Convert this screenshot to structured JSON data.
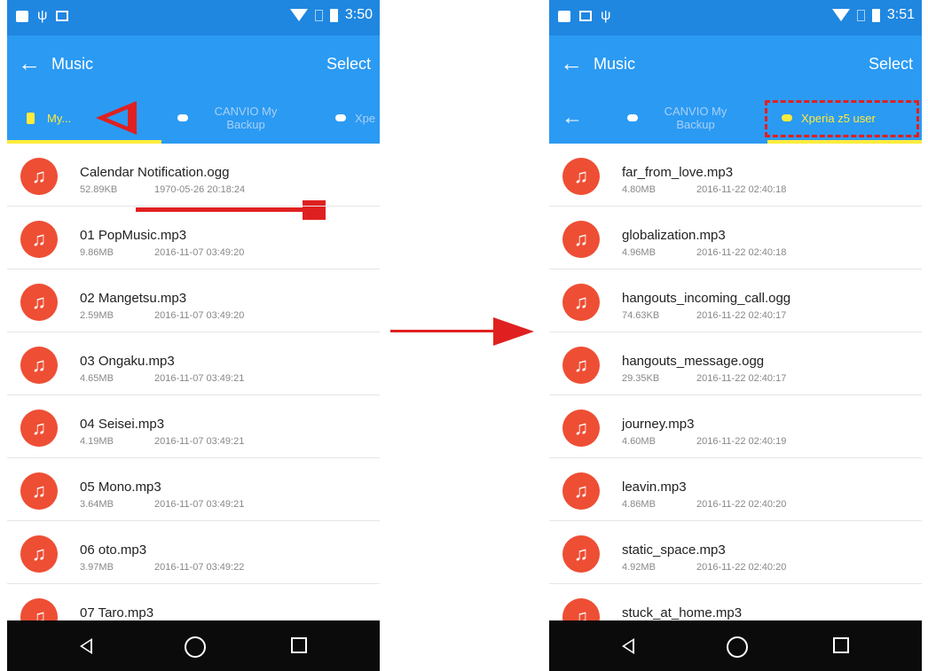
{
  "left_screen": {
    "status": {
      "time": "3:50"
    },
    "app_bar": {
      "title": "Music",
      "select_label": "Select"
    },
    "tabs": [
      {
        "label": "My..."
      },
      {
        "label": "CANVIO My Backup"
      },
      {
        "label": "Xpe"
      }
    ],
    "files": [
      {
        "name": "Calendar Notification.ogg",
        "size": "52.89KB",
        "date": "1970-05-26 20:18:24"
      },
      {
        "name": "01 PopMusic.mp3",
        "size": "9.86MB",
        "date": "2016-11-07 03:49:20"
      },
      {
        "name": "02 Mangetsu.mp3",
        "size": "2.59MB",
        "date": "2016-11-07 03:49:20"
      },
      {
        "name": "03 Ongaku.mp3",
        "size": "4.65MB",
        "date": "2016-11-07 03:49:21"
      },
      {
        "name": "04 Seisei.mp3",
        "size": "4.19MB",
        "date": "2016-11-07 03:49:21"
      },
      {
        "name": "05 Mono.mp3",
        "size": "3.64MB",
        "date": "2016-11-07 03:49:21"
      },
      {
        "name": "06 oto.mp3",
        "size": "3.97MB",
        "date": "2016-11-07 03:49:22"
      },
      {
        "name": "07 Taro.mp3"
      }
    ]
  },
  "right_screen": {
    "status": {
      "time": "3:51"
    },
    "app_bar": {
      "title": "Music",
      "select_label": "Select"
    },
    "tabs": [
      {
        "label": "CANVIO My Backup"
      },
      {
        "label": "Xperia z5 user"
      }
    ],
    "files": [
      {
        "name": "far_from_love.mp3",
        "size": "4.80MB",
        "date": "2016-11-22 02:40:18"
      },
      {
        "name": "globalization.mp3",
        "size": "4.96MB",
        "date": "2016-11-22 02:40:18"
      },
      {
        "name": "hangouts_incoming_call.ogg",
        "size": "74.63KB",
        "date": "2016-11-22 02:40:17"
      },
      {
        "name": "hangouts_message.ogg",
        "size": "29.35KB",
        "date": "2016-11-22 02:40:17"
      },
      {
        "name": "journey.mp3",
        "size": "4.60MB",
        "date": "2016-11-22 02:40:19"
      },
      {
        "name": "leavin.mp3",
        "size": "4.86MB",
        "date": "2016-11-22 02:40:20"
      },
      {
        "name": "static_space.mp3",
        "size": "4.92MB",
        "date": "2016-11-22 02:40:20"
      },
      {
        "name": "stuck_at_home.mp3"
      }
    ]
  },
  "colors": {
    "status_bar": "#1f87e0",
    "app_bar": "#2b9af3",
    "tab_indicator": "#ffeb3b",
    "music_icon": "#ee4e34",
    "annotation_red": "#e02020",
    "nav_bar": "#0b0b0b"
  },
  "icons": {
    "back": "arrow-left-icon",
    "music": "music-note-icon",
    "nav_back": "triangle-back-icon",
    "nav_home": "circle-home-icon",
    "nav_recent": "square-recents-icon"
  }
}
